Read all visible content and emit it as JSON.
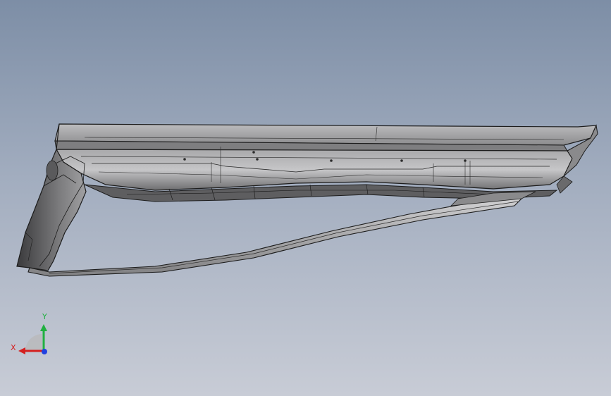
{
  "viewport": {
    "background_top": "#7d8ea6",
    "background_bottom": "#c8ccd6"
  },
  "model": {
    "edge_color": "#1c1c1c",
    "body_color": "#9a9a9c",
    "highlight_color": "#c4c4c6",
    "shadow_color": "#4a4a4c"
  },
  "triad": {
    "x_label": "X",
    "y_label": "Y",
    "x_color": "#d42020",
    "y_color": "#20b040",
    "z_color": "#2040e0",
    "plane_color": "#b8b8b8"
  }
}
